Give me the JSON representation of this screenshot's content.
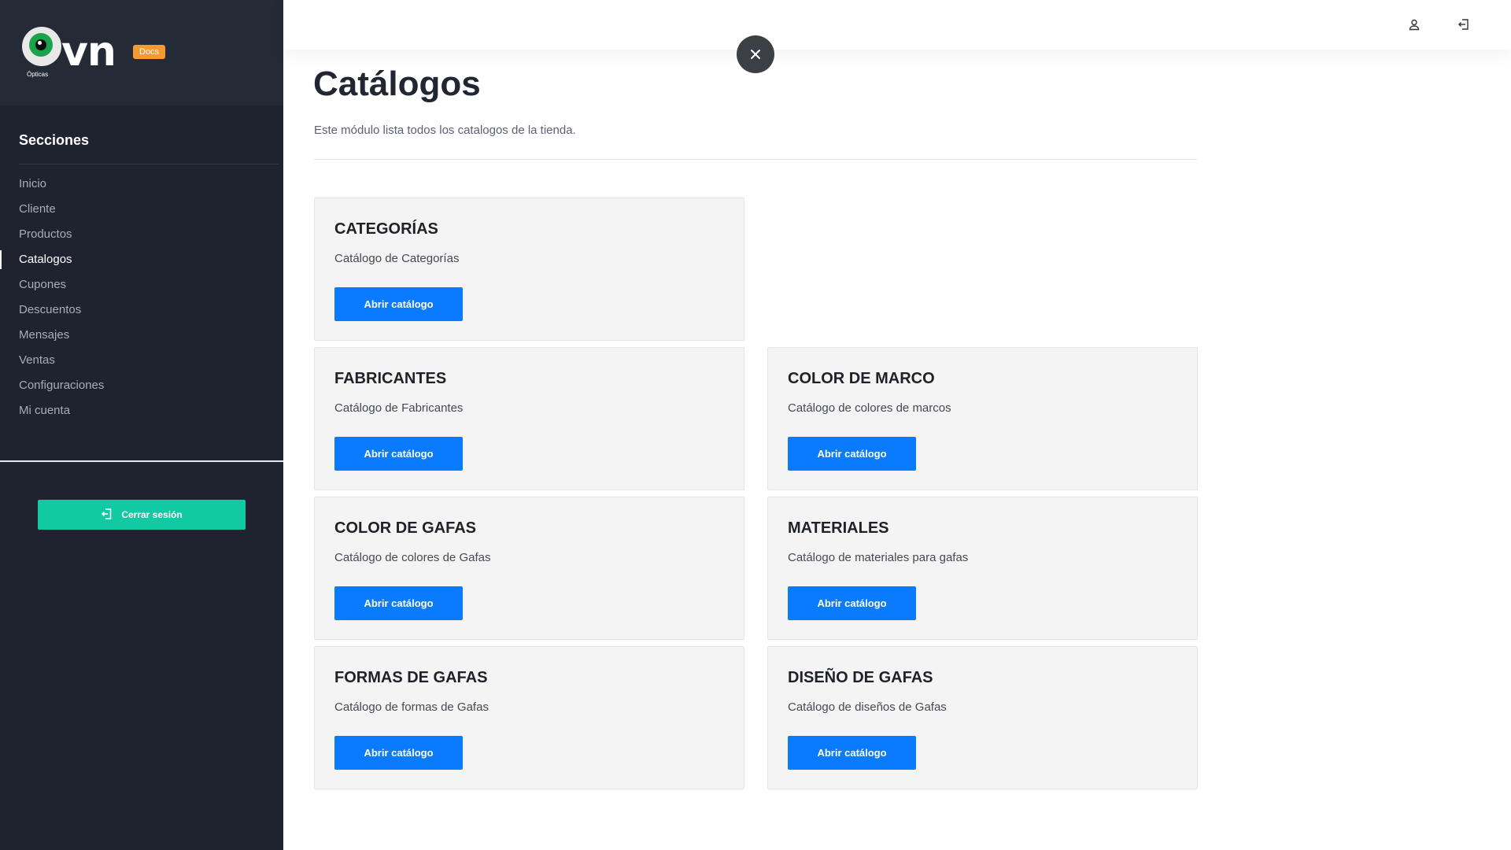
{
  "brand": {
    "logo_text": "vn",
    "logo_subtext": "Ópticas",
    "badge": "Docs"
  },
  "sidebar": {
    "section_title": "Secciones",
    "items": [
      {
        "label": "Inicio",
        "active": false
      },
      {
        "label": "Cliente",
        "active": false
      },
      {
        "label": "Productos",
        "active": false
      },
      {
        "label": "Catalogos",
        "active": true
      },
      {
        "label": "Cupones",
        "active": false
      },
      {
        "label": "Descuentos",
        "active": false
      },
      {
        "label": "Mensajes",
        "active": false
      },
      {
        "label": "Ventas",
        "active": false
      },
      {
        "label": "Configuraciones",
        "active": false
      },
      {
        "label": "Mi cuenta",
        "active": false
      }
    ],
    "logout_label": "Cerrar sesión"
  },
  "topbar": {
    "icons": [
      "user-icon",
      "logout-icon"
    ]
  },
  "page": {
    "title": "Catálogos",
    "description": "Este módulo lista todos los catalogos de la tienda."
  },
  "catalogs": [
    {
      "title": "CATEGORÍAS",
      "description": "Catálogo de Categorías",
      "button": "Abrir catálogo"
    },
    {
      "title": "FABRICANTES",
      "description": "Catálogo de Fabricantes",
      "button": "Abrir catálogo"
    },
    {
      "title": "COLOR DE MARCO",
      "description": "Catálogo de colores de marcos",
      "button": "Abrir catálogo"
    },
    {
      "title": "COLOR DE GAFAS",
      "description": "Catálogo de colores de Gafas",
      "button": "Abrir catálogo"
    },
    {
      "title": "MATERIALES",
      "description": "Catálogo de materiales para gafas",
      "button": "Abrir catálogo"
    },
    {
      "title": "FORMAS DE GAFAS",
      "description": "Catálogo de formas de Gafas",
      "button": "Abrir catálogo"
    },
    {
      "title": "DISEÑO DE GAFAS",
      "description": "Catálogo de diseños de Gafas",
      "button": "Abrir catálogo"
    }
  ],
  "colors": {
    "sidebar_bg": "#1f2330",
    "accent_blue": "#0a7bff",
    "logout_green": "#11c9a3",
    "badge_orange": "#f49a31"
  }
}
